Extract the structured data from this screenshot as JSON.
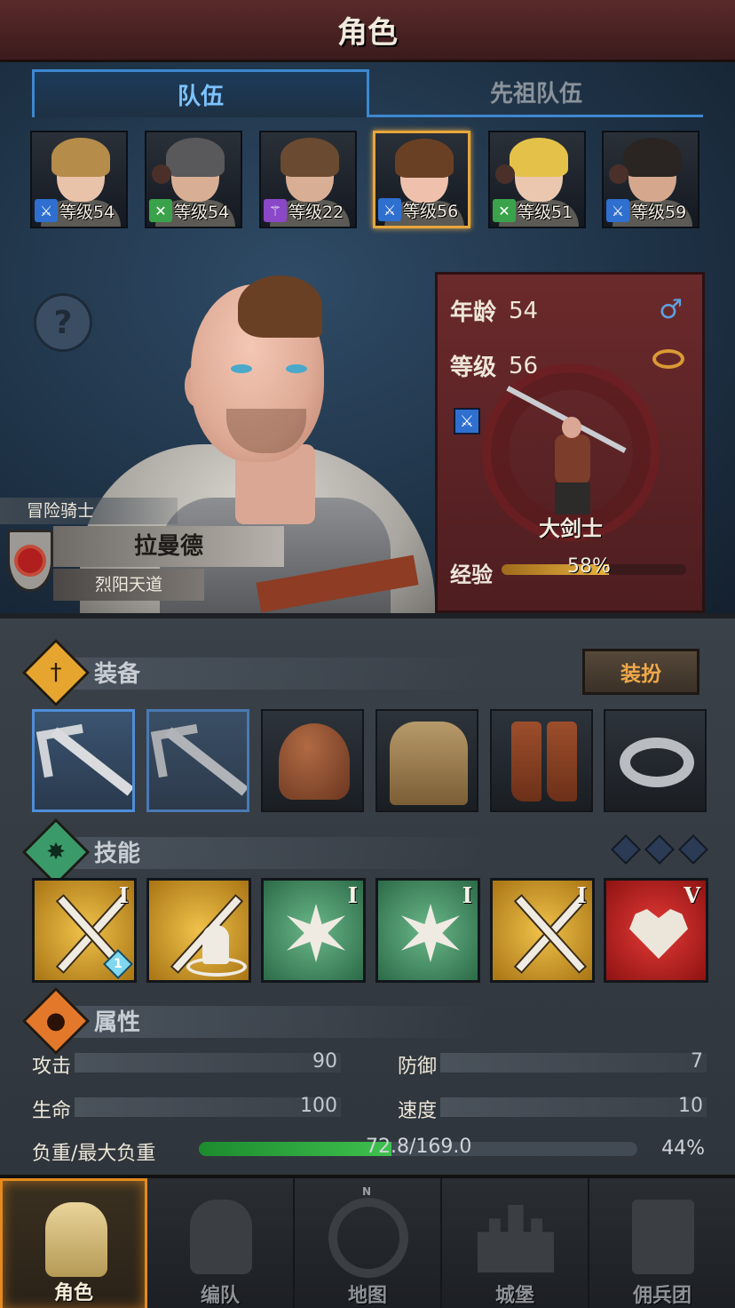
{
  "header": {
    "title": "角色"
  },
  "tabs": [
    {
      "label": "队伍"
    },
    {
      "label": "先祖队伍"
    }
  ],
  "roster": [
    {
      "level_text": "等级54",
      "class_icon": "sword-icon",
      "class_color": "#2f6fd0",
      "hair_color": "#b58c4a",
      "skin_color": "#e9c2aa"
    },
    {
      "level_text": "等级54",
      "class_icon": "bow-icon",
      "class_color": "#3aa24a",
      "hair_color": "#59585a",
      "skin_color": "#d8ae94"
    },
    {
      "level_text": "等级22",
      "class_icon": "staff-icon",
      "class_color": "#8a48c8",
      "hair_color": "#6a4a30",
      "skin_color": "#d8ae94"
    },
    {
      "level_text": "等级56",
      "class_icon": "sword-icon",
      "class_color": "#2f6fd0",
      "hair_color": "#6a4024",
      "skin_color": "#efc1ad",
      "selected": true
    },
    {
      "level_text": "等级51",
      "class_icon": "bow-icon",
      "class_color": "#3aa24a",
      "hair_color": "#e4c24a",
      "skin_color": "#ecc7b0"
    },
    {
      "level_text": "等级59",
      "class_icon": "sword-icon",
      "class_color": "#2f6fd0",
      "hair_color": "#2a2522",
      "skin_color": "#d5a88e"
    }
  ],
  "character": {
    "title": "冒险骑士",
    "name": "拉曼德",
    "faction": "烈阳天道",
    "age_label": "年龄",
    "age": "54",
    "level_label": "等级",
    "level": "56",
    "gender_icon": "male-icon",
    "class_name": "大剑士",
    "exp_label": "经验",
    "exp_percent_text": "58%",
    "exp_fraction": 0.58
  },
  "equipment": {
    "section_title": "装备",
    "dress_button": "装扮",
    "slots": [
      "axe-weapon",
      "axe-weapon",
      "leather-helmet",
      "leather-armor",
      "leather-boots",
      "silver-ring"
    ]
  },
  "skills": {
    "section_title": "技能",
    "items": [
      {
        "name": "dual-swords-skill",
        "style": "gold",
        "rank": "I",
        "gem": "1"
      },
      {
        "name": "rally-skill",
        "style": "gold",
        "rank": ""
      },
      {
        "name": "crystal-burst-skill",
        "style": "green",
        "rank": "I"
      },
      {
        "name": "burst-skill",
        "style": "green",
        "rank": "I"
      },
      {
        "name": "cross-swords-skill",
        "style": "gold",
        "rank": "I"
      },
      {
        "name": "heartbeat-skill",
        "style": "red",
        "rank": "V"
      }
    ]
  },
  "attributes": {
    "section_title": "属性",
    "attack_label": "攻击",
    "attack": "90",
    "defense_label": "防御",
    "defense": "7",
    "hp_label": "生命",
    "hp": "100",
    "speed_label": "速度",
    "speed": "10",
    "load_label": "负重/最大负重",
    "load_text": "72.8/169.0",
    "load_percent_text": "44%",
    "load_fraction": 0.44
  },
  "nav": [
    {
      "label": "角色",
      "active": true
    },
    {
      "label": "编队"
    },
    {
      "label": "地图",
      "north": "N"
    },
    {
      "label": "城堡"
    },
    {
      "label": "佣兵团"
    }
  ]
}
